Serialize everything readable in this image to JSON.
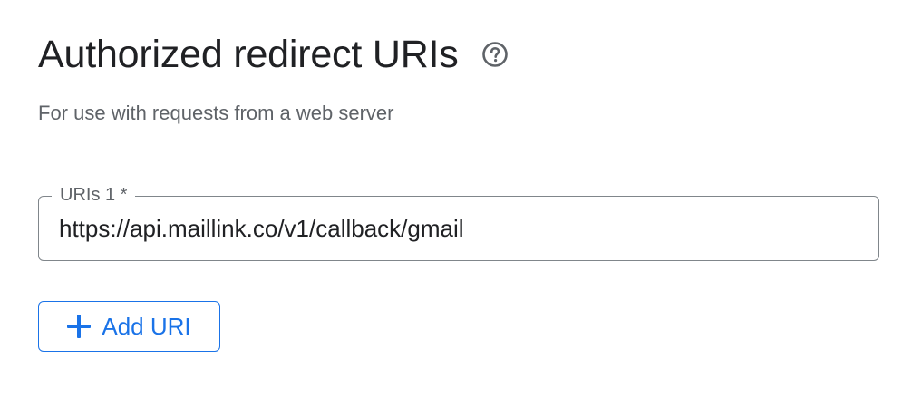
{
  "section": {
    "title": "Authorized redirect URIs",
    "help_icon": "help-circle-icon",
    "subtitle": "For use with requests from a web server"
  },
  "uri_field": {
    "label": "URIs 1 *",
    "value": "https://api.maillink.co/v1/callback/gmail"
  },
  "add_button": {
    "icon": "plus-icon",
    "label": "Add URI"
  },
  "colors": {
    "accent": "#1a73e8",
    "text_primary": "#202124",
    "text_secondary": "#5f6368",
    "border": "#80868b"
  }
}
